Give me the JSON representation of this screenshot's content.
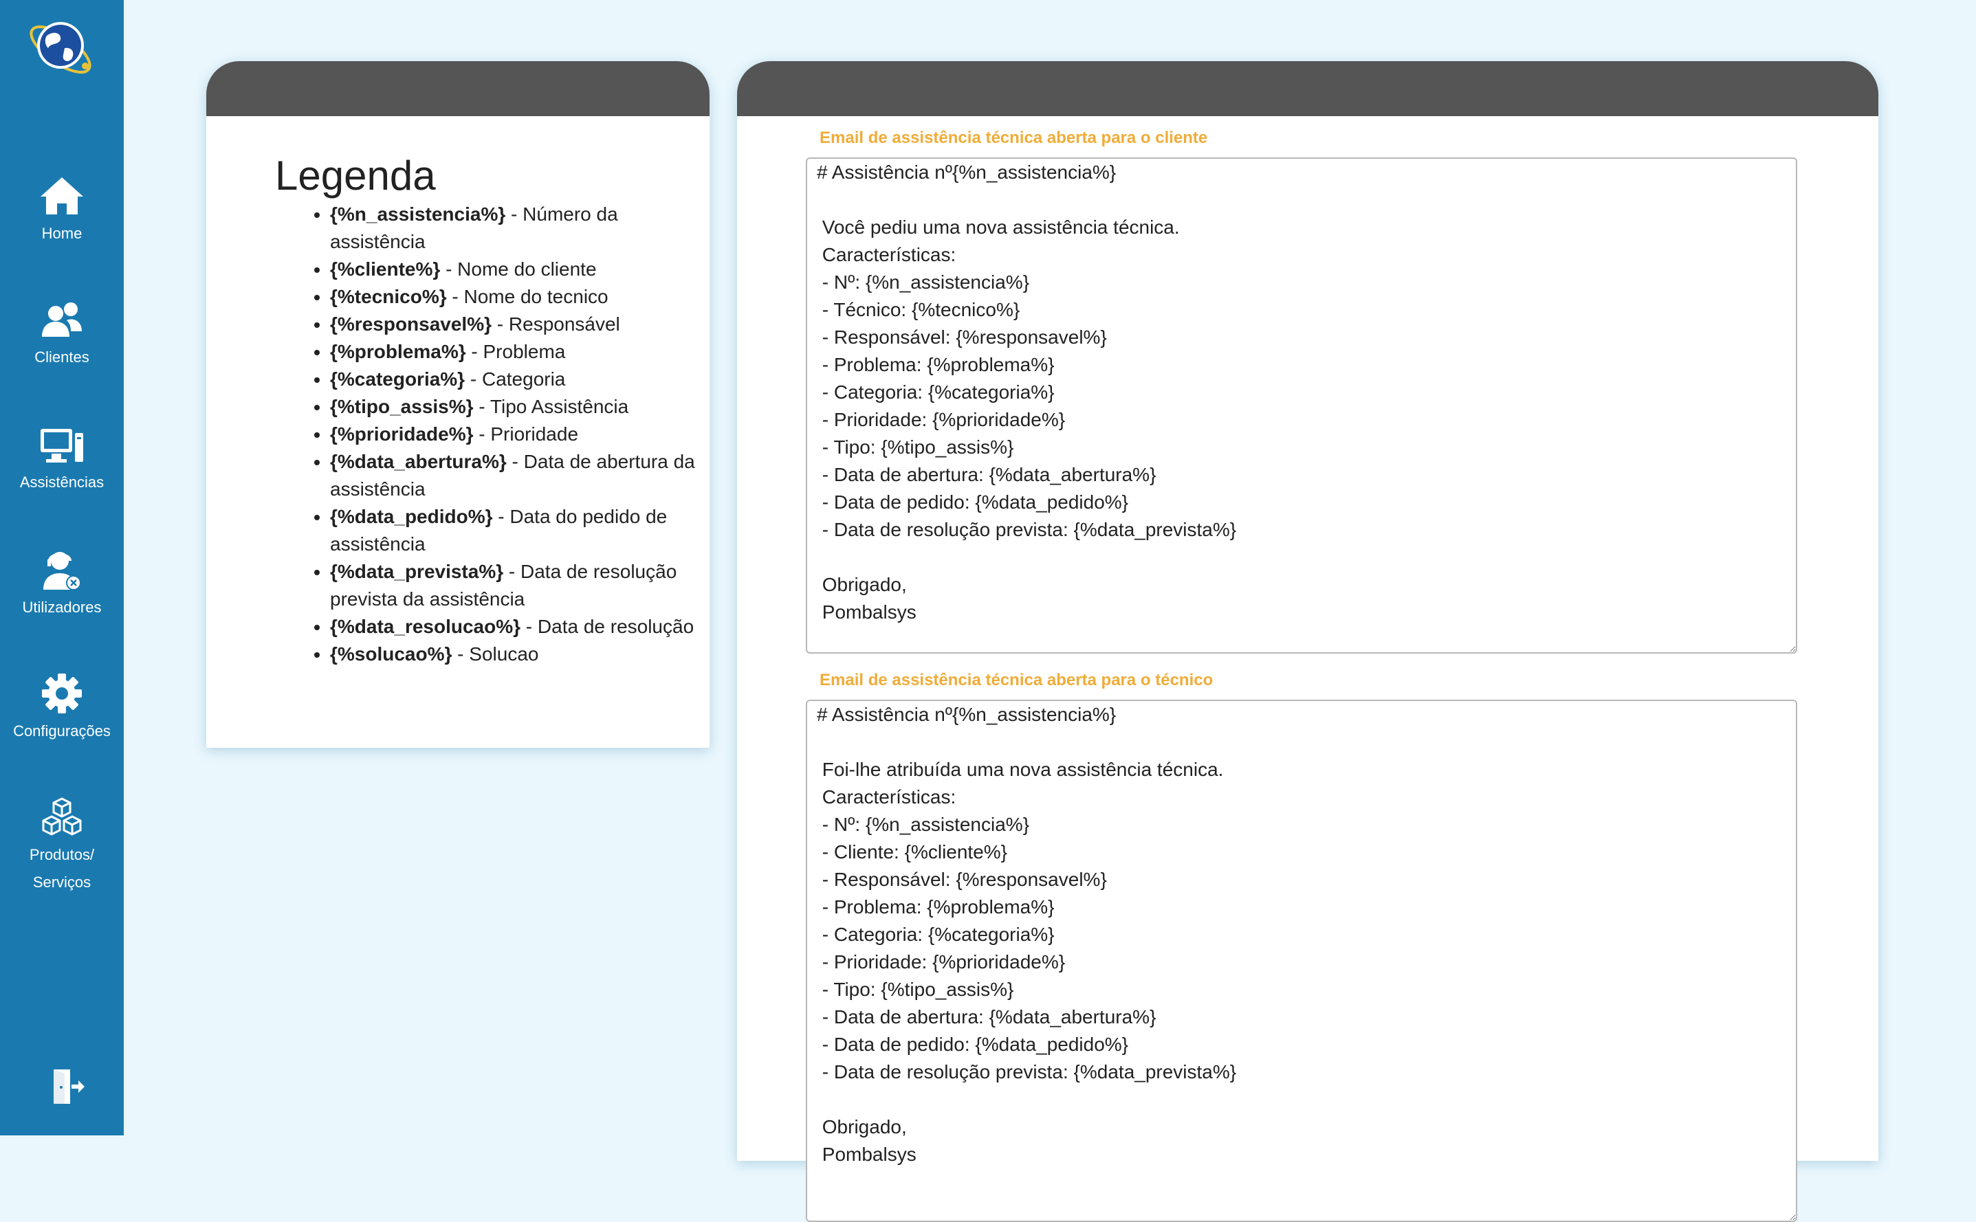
{
  "sidebar": {
    "items": [
      {
        "label": "Home",
        "icon": "home-icon"
      },
      {
        "label": "Clientes",
        "icon": "users-icon"
      },
      {
        "label": "Assistências",
        "icon": "computer-icon"
      },
      {
        "label": "Utilizadores",
        "icon": "support-agent-icon"
      },
      {
        "label": "Configurações",
        "icon": "gear-icon"
      },
      {
        "label_line1": "Produtos/",
        "label_line2": "Serviços",
        "icon": "boxes-icon"
      }
    ],
    "logout_icon": "logout-icon",
    "logo_icon": "globe-logo-icon"
  },
  "legend": {
    "title": "Legenda",
    "items": [
      {
        "key": "{%n_assistencia%}",
        "desc": " - Número da assistência"
      },
      {
        "key": "{%cliente%}",
        "desc": " - Nome do cliente"
      },
      {
        "key": "{%tecnico%}",
        "desc": " - Nome do tecnico"
      },
      {
        "key": "{%responsavel%}",
        "desc": " - Responsável"
      },
      {
        "key": "{%problema%}",
        "desc": " - Problema"
      },
      {
        "key": "{%categoria%}",
        "desc": " - Categoria"
      },
      {
        "key": "{%tipo_assis%}",
        "desc": " - Tipo Assistência"
      },
      {
        "key": "{%prioridade%}",
        "desc": " - Prioridade"
      },
      {
        "key": "{%data_abertura%}",
        "desc": " - Data de abertura da assistência"
      },
      {
        "key": "{%data_pedido%}",
        "desc": " - Data do pedido de assistência"
      },
      {
        "key": "{%data_prevista%}",
        "desc": " - Data de resolução prevista da assistência"
      },
      {
        "key": "{%data_resolucao%}",
        "desc": " - Data de resolução"
      },
      {
        "key": "{%solucao%}",
        "desc": " - Solucao"
      }
    ]
  },
  "emails": {
    "client": {
      "label": "Email de assistência técnica aberta para o cliente",
      "text": "# Assistência nº{%n_assistencia%}\n\n Você pediu uma nova assistência técnica.\n Características:\n - Nº: {%n_assistencia%}\n - Técnico: {%tecnico%}\n - Responsável: {%responsavel%}\n - Problema: {%problema%}\n - Categoria: {%categoria%}\n - Prioridade: {%prioridade%}\n - Tipo: {%tipo_assis%}\n - Data de abertura: {%data_abertura%}\n - Data de pedido: {%data_pedido%}\n - Data de resolução prevista: {%data_prevista%}\n\n Obrigado,\n Pombalsys"
    },
    "technician": {
      "label": "Email de assistência técnica aberta para o técnico",
      "text": "# Assistência nº{%n_assistencia%}\n\n Foi-lhe atribuída uma nova assistência técnica.\n Características:\n - Nº: {%n_assistencia%}\n - Cliente: {%cliente%}\n - Responsável: {%responsavel%}\n - Problema: {%problema%}\n - Categoria: {%categoria%}\n - Prioridade: {%prioridade%}\n - Tipo: {%tipo_assis%}\n - Data de abertura: {%data_abertura%}\n - Data de pedido: {%data_pedido%}\n - Data de resolução prevista: {%data_prevista%}\n\n Obrigado,\n Pombalsys"
    }
  },
  "colors": {
    "sidebar": "#1a7ab0",
    "background": "#eaf7fd",
    "card_header": "#555555",
    "field_label": "#f0ac38"
  }
}
